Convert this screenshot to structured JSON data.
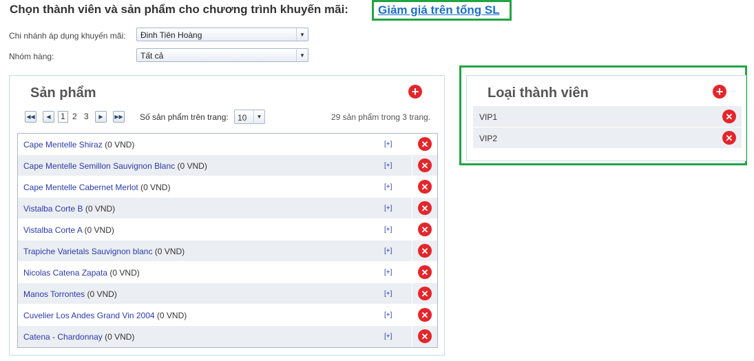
{
  "header": {
    "title": "Chọn thành viên và sản phẩm cho chương trình khuyến mãi:",
    "promo_link": "Giảm giá trên tổng SL"
  },
  "filters": {
    "branch_label": "Chi nhánh áp dụng khuyến mãi:",
    "branch_value": "Đinh Tiên Hoàng",
    "group_label": "Nhóm hàng:",
    "group_value": "Tất cả"
  },
  "products": {
    "title": "Sản phẩm",
    "pager": {
      "pages": [
        "1",
        "2",
        "3"
      ],
      "current_page": "1",
      "per_page_label": "Số sản phẩm trên trang:",
      "per_page_value": "10",
      "summary": "29 sản phẩm trong 3 trang."
    },
    "expand_label": "[+]",
    "rows": [
      {
        "name": "Cape Mentelle Shiraz",
        "price": "(0 VND)"
      },
      {
        "name": "Cape Mentelle Semillon Sauvignon Blanc",
        "price": "(0 VND)"
      },
      {
        "name": "Cape Mentelle Cabernet Merlot",
        "price": "(0 VND)"
      },
      {
        "name": "Vistalba Corte B",
        "price": "(0 VND)"
      },
      {
        "name": "Vistalba Corte A",
        "price": "(0 VND)"
      },
      {
        "name": "Trapiche Varietals Sauvignon blanc",
        "price": "(0 VND)"
      },
      {
        "name": "Nicolas Catena Zapata",
        "price": "(0 VND)"
      },
      {
        "name": "Manos Torrontes",
        "price": "(0 VND)"
      },
      {
        "name": "Cuvelier Los Andes Grand Vin 2004",
        "price": "(0 VND)"
      },
      {
        "name": "Catena - Chardonnay",
        "price": "(0 VND)"
      }
    ]
  },
  "members": {
    "title": "Loại thành viên",
    "rows": [
      {
        "name": "VIP1"
      },
      {
        "name": "VIP2"
      }
    ]
  },
  "colors": {
    "highlight": "#22a443",
    "link": "#1a6fc4",
    "icon_red": "#e3262b",
    "row_alt": "#ebeef2"
  },
  "icons": {
    "add": "plus-circle-icon",
    "remove": "x-circle-icon",
    "first": "first-page-icon",
    "prev": "prev-page-icon",
    "next": "next-page-icon",
    "last": "last-page-icon",
    "dropdown": "chevron-down-icon"
  }
}
